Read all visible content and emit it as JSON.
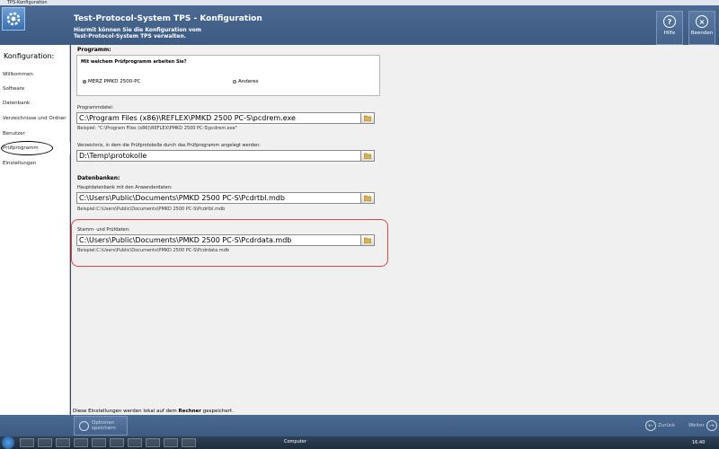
{
  "window": {
    "title": "TPS-Konfiguration"
  },
  "header": {
    "title": "Test-Protocol-System TPS - Konfiguration",
    "subtitle_line1": "Hiermit können Sie die Konfiguration vom",
    "subtitle_line2": "Test-Protocol-System TPS verwalten.",
    "help_label": "Hilfe",
    "exit_label": "Beenden"
  },
  "sidebar": {
    "title": "Konfiguration:",
    "items": [
      {
        "label": "Willkommen"
      },
      {
        "label": "Software"
      },
      {
        "label": "Datenbank"
      },
      {
        "label": "Verzeichnisse und Ordner"
      },
      {
        "label": "Benutzer"
      },
      {
        "label": "Prüfprogramm"
      },
      {
        "label": "Einstellungen"
      }
    ]
  },
  "program": {
    "section_title": "Programm:",
    "question": "Mit welchem Prüfprogramm arbeiten Sie?",
    "options": [
      {
        "label": "MERZ PMKD 2500-PC",
        "selected": true
      },
      {
        "label": "Anderes",
        "selected": false
      }
    ],
    "file_label": "Programmdatei:",
    "file_value": "C:\\Program Files (x86)\\REFLEX\\PMKD 2500 PC-S\\pcdrem.exe",
    "file_hint": "Beispiel: \"C:\\Program Files (x86)\\REFLEX\\PMKD 2500 PC-S\\pcdrem.exe\"",
    "dir_label": "Verzeichnis, in dem die Prüfprotokolle durch das Prüfprogramm angelegt werden:",
    "dir_value": "D:\\Temp\\protokolle"
  },
  "databases": {
    "section_title": "Datenbanken:",
    "main_label": "Hauptdatenbank mit den Anwenderdaten:",
    "main_value": "C:\\Users\\Public\\Documents\\PMKD 2500 PC-S\\Pcdrtbl.mdb",
    "main_hint": "Beispiel:C:\\Users\\Public\\Documents\\PMKD 2500 PC-S\\Pcdrtbl.mdb",
    "master_label": "Stamm- und Prüfdaten:",
    "master_value": "C:\\Users\\Public\\Documents\\PMKD 2500 PC-S\\Pcdrdata.mdb",
    "master_hint": "Beispiel:C:\\Users\\Public\\Documents\\PMKD 2500 PC-S\\Pcdrdata.mdb"
  },
  "footer": {
    "note_prefix": "Diese Einstellungen werden lokal auf dem ",
    "note_bold": "Rechner",
    "note_suffix": " gespeichert.",
    "save_line1": "Optionen",
    "save_line2": "speichern",
    "back_label": "Zurück",
    "next_label": "Weiter"
  },
  "taskbar": {
    "tray_text": "Computer",
    "clock": "16:40"
  },
  "colors": {
    "header": "#4b6a93",
    "highlight_red": "#d9464e"
  }
}
